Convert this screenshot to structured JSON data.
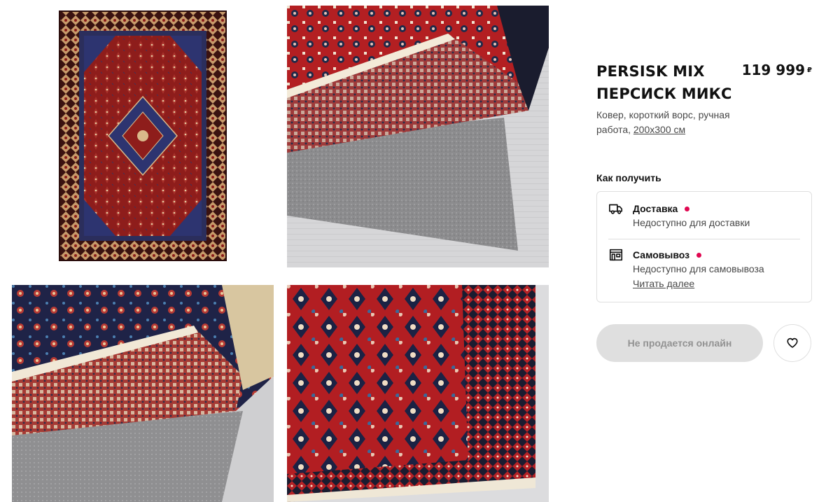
{
  "gallery": {
    "images": [
      {
        "alt": "persisk-mix-rug-full"
      },
      {
        "alt": "persisk-mix-rug-corner-with-pad"
      },
      {
        "alt": "persisk-mix-rug-back-fringe"
      },
      {
        "alt": "persisk-mix-rug-detail-border"
      }
    ]
  },
  "product": {
    "name_latin": "PERSISK MIX",
    "name_cyrillic": "ПЕРСИСК МИКС",
    "price": "119 999",
    "currency": "₽",
    "description": "Ковер, короткий ворс, ручная работа, ",
    "size": "200x300 см"
  },
  "availability": {
    "title": "Как получить",
    "delivery": {
      "label": "Доставка",
      "status": "Недоступно для доставки",
      "icon": "truck-icon",
      "status_color": "#e00751"
    },
    "pickup": {
      "label": "Самовывоз",
      "status": "Недоступно для самовывоза",
      "link": "Читать далее",
      "icon": "store-icon",
      "status_color": "#e00751"
    }
  },
  "actions": {
    "buy_label": "Не продается онлайн",
    "favorite_icon": "heart-icon"
  }
}
